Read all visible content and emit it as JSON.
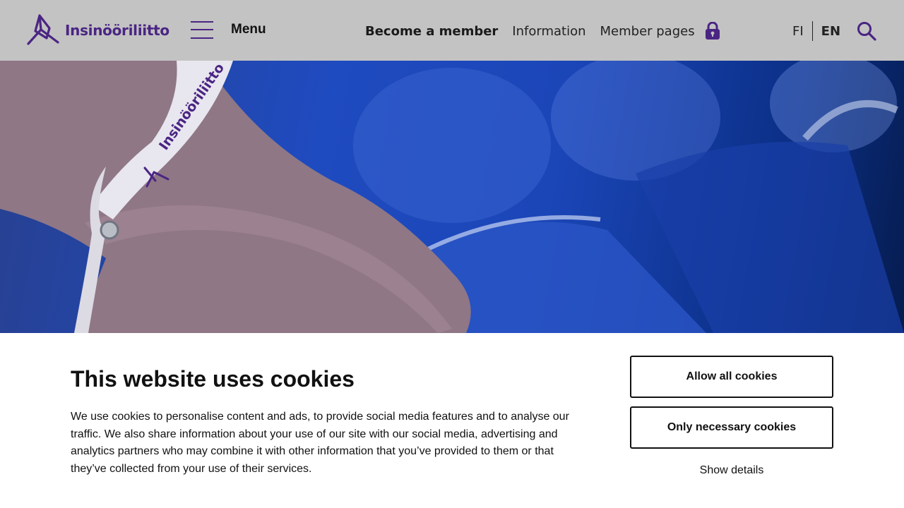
{
  "header": {
    "logo_text": "Insinööriliitto",
    "menu_label": "Menu",
    "nav": {
      "become_member": "Become a member",
      "information": "Information",
      "member_pages": "Member pages"
    },
    "lang": {
      "fi": "FI",
      "en": "EN"
    },
    "icons": [
      "hamburger-icon",
      "lock-icon",
      "search-icon"
    ],
    "brand_color": "#4a2583"
  },
  "hero": {
    "wristband_text": "Insinööriliitto"
  },
  "cookie_banner": {
    "title": "This website uses cookies",
    "body": "We use cookies to personalise content and ads, to provide social media features and to analyse our traffic. We also share information about your use of our site with our social media, advertising and analytics partners who may combine it with other information that you’ve provided to them or that they’ve collected from your use of their services.",
    "allow_all": "Allow all cookies",
    "only_necessary": "Only necessary cookies",
    "show_details": "Show details"
  }
}
